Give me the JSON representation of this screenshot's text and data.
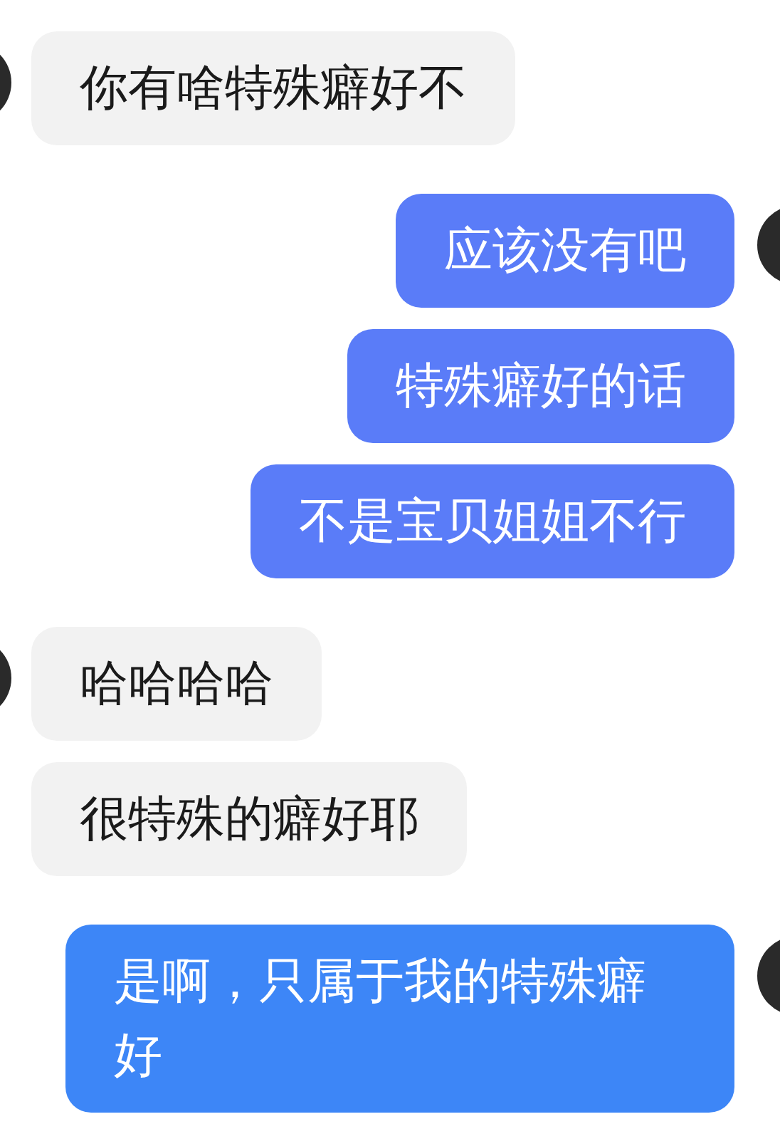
{
  "groups": [
    {
      "kind": "incoming",
      "messages": [
        {
          "text": "你有啥特殊癖好不",
          "color": "#f2f2f2"
        }
      ]
    },
    {
      "kind": "outgoing",
      "messages": [
        {
          "text": "应该没有吧",
          "color": "#5a7cf8"
        },
        {
          "text": "特殊癖好的话",
          "color": "#5a7cf8"
        },
        {
          "text": "不是宝贝姐姐不行",
          "color": "#5a7cf8"
        }
      ]
    },
    {
      "kind": "incoming",
      "messages": [
        {
          "text": "哈哈哈哈",
          "color": "#f2f2f2"
        },
        {
          "text": "很特殊的癖好耶",
          "color": "#f2f2f2"
        }
      ]
    },
    {
      "kind": "outgoing",
      "messages": [
        {
          "text": "是啊，只属于我的特殊癖好",
          "color": "#3d86f7"
        }
      ]
    }
  ]
}
